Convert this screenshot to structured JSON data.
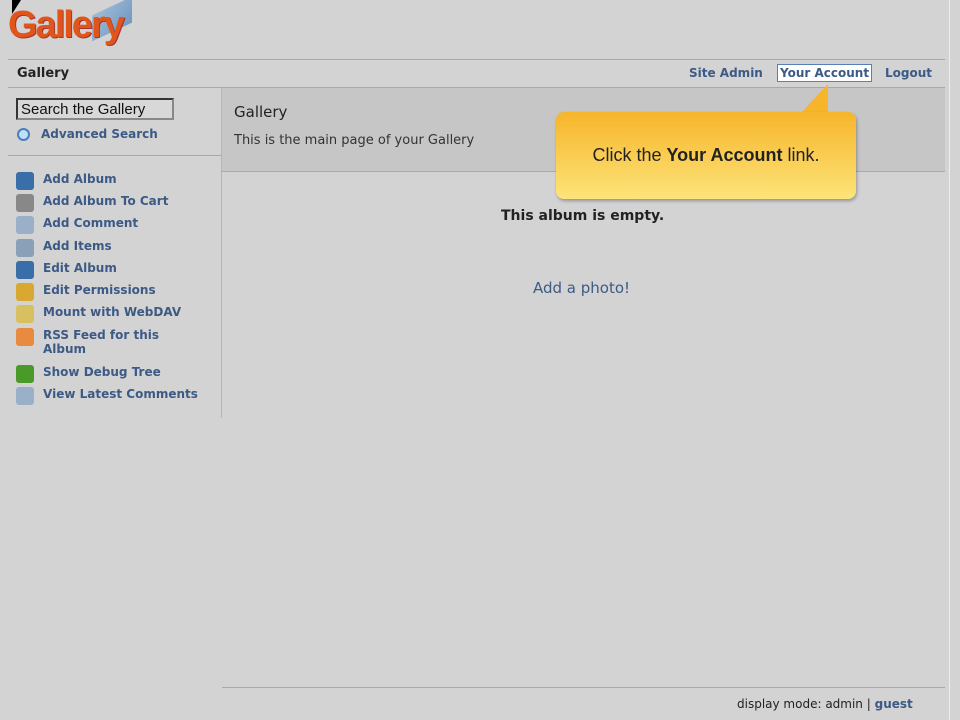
{
  "logo": "Gallery",
  "nav": {
    "title": "Gallery",
    "links": [
      "Site Admin",
      "Your Account",
      "Logout"
    ]
  },
  "sidebar": {
    "search_placeholder": "Search the Gallery",
    "advanced_search": "Advanced Search",
    "items": [
      {
        "label": "Add Album",
        "icon": "add-album-icon",
        "color": "#3a6ea8"
      },
      {
        "label": "Add Album To Cart",
        "icon": "cart-icon",
        "color": "#888888"
      },
      {
        "label": "Add Comment",
        "icon": "comment-add-icon",
        "color": "#9ab0c8"
      },
      {
        "label": "Add Items",
        "icon": "add-items-icon",
        "color": "#8aa0b8"
      },
      {
        "label": "Edit Album",
        "icon": "edit-album-icon",
        "color": "#3a6ea8"
      },
      {
        "label": "Edit Permissions",
        "icon": "lock-icon",
        "color": "#d8a830"
      },
      {
        "label": "Mount with WebDAV",
        "icon": "folder-icon",
        "color": "#d8c060"
      },
      {
        "label": "RSS Feed for this Album",
        "icon": "rss-icon",
        "color": "#e88a40"
      },
      {
        "label": "Show Debug Tree",
        "icon": "bug-icon",
        "color": "#4a9a2a"
      },
      {
        "label": "View Latest Comments",
        "icon": "comments-icon",
        "color": "#9ab0c8"
      }
    ]
  },
  "main": {
    "title": "Gallery",
    "description": "This is the main page of your Gallery",
    "empty": "This album is empty.",
    "add_photo": "Add a photo!"
  },
  "callout": {
    "pre": "Click the ",
    "bold": "Your Account",
    "post": " link."
  },
  "footer": {
    "label": "display mode: admin",
    "sep": "|",
    "guest": "guest"
  }
}
